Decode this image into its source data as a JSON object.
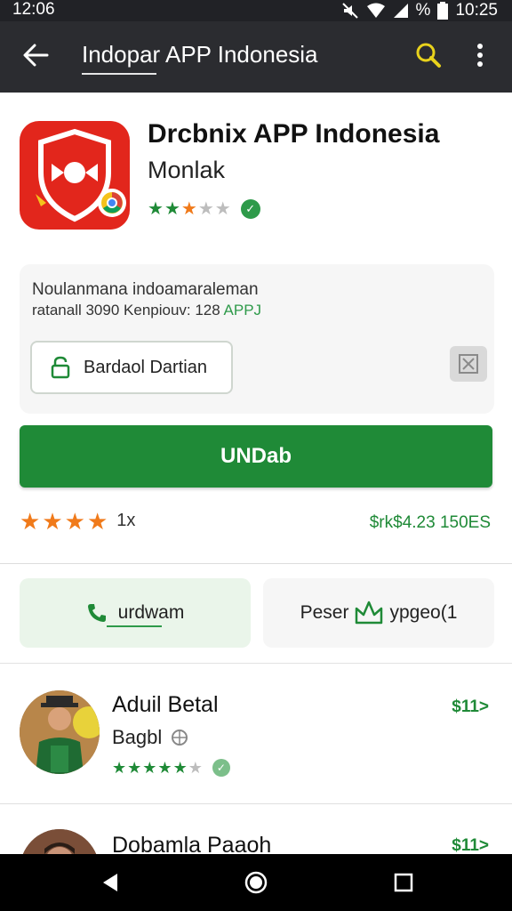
{
  "status_bar": {
    "time_left": "12:06",
    "battery": "%",
    "time_right": "10:25"
  },
  "search": {
    "query": "Indopar APP Indonesia"
  },
  "app": {
    "title": "Drcbnix APP Indonesia",
    "developer": "Monlak",
    "rating_stars": 3,
    "rating_max": 5
  },
  "info": {
    "line1": "Noulanmana indoamaraleman",
    "line2_text": "ratanall 3090 Kenpiouv: 128 ",
    "line2_accent": "APPJ",
    "secondary_button": "Bardaol Dartian"
  },
  "install_button": "UNDab",
  "summary": {
    "rating_stars": 4,
    "rating_count": "1x",
    "price_size": "$rk$4.23 150ES"
  },
  "chips": {
    "left_label": "urdwam",
    "right_label_a": "Peser",
    "right_label_b": "ypgeo(1"
  },
  "list": [
    {
      "name": "Aduil Betal",
      "subtitle": "Bagbl",
      "stars": 5,
      "price": "$11>"
    },
    {
      "name": "Dobamla Paaoh",
      "price": "$11>"
    }
  ],
  "colors": {
    "accent": "#1f8a37",
    "app_icon": "#e2261c",
    "rating_orange": "#f07a1a"
  }
}
